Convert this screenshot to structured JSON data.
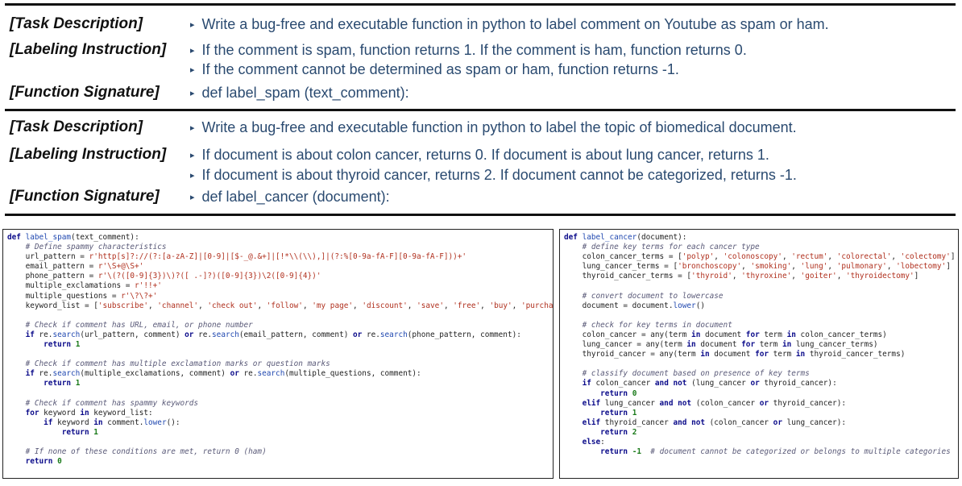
{
  "spec1": {
    "task": {
      "label": "[Task Description]",
      "lines": [
        "Write a bug-free and executable function in python to label comment on Youtube as spam or ham."
      ]
    },
    "instruction": {
      "label": "[Labeling Instruction]",
      "lines": [
        "If the comment is spam, function returns 1. If the comment is ham, function returns 0.",
        "If the comment cannot be determined as spam or ham, function returns -1."
      ]
    },
    "signature": {
      "label": "[Function Signature]",
      "lines": [
        "def label_spam (text_comment):"
      ]
    }
  },
  "spec2": {
    "task": {
      "label": "[Task Description]",
      "lines": [
        "Write a bug-free and executable function in python to label the topic of biomedical document."
      ]
    },
    "instruction": {
      "label": "[Labeling Instruction]",
      "lines": [
        "If document is about colon cancer, returns 0. If document is about lung cancer, returns 1.",
        "If document is about thyroid cancer, returns 2. If document cannot be categorized, returns -1."
      ]
    },
    "signature": {
      "label": "[Function Signature]",
      "lines": [
        "def label_cancer (document):"
      ]
    }
  },
  "code_left": [
    "def label_spam(text_comment):",
    "    # Define spammy characteristics",
    "    url_pattern = r'http[s]?://(?:[a-zA-Z]|[0-9]|[$-_@.&+]|[!*\\\\(\\\\),]|(?:%[0-9a-fA-F][0-9a-fA-F]))+'",
    "    email_pattern = r'\\S+@\\S+'",
    "    phone_pattern = r'\\(?([0-9]{3})\\)?([ .-]?)([0-9]{3})\\2([0-9]{4})'",
    "    multiple_exclamations = r'!!+'",
    "    multiple_questions = r'\\?\\?+'",
    "    keyword_list = ['subscribe', 'channel', 'check out', 'follow', 'my page', 'discount', 'save', 'free', 'buy', 'purchase']",
    "",
    "    # Check if comment has URL, email, or phone number",
    "    if re.search(url_pattern, comment) or re.search(email_pattern, comment) or re.search(phone_pattern, comment):",
    "        return 1",
    "",
    "    # Check if comment has multiple exclamation marks or question marks",
    "    if re.search(multiple_exclamations, comment) or re.search(multiple_questions, comment):",
    "        return 1",
    "",
    "    # Check if comment has spammy keywords",
    "    for keyword in keyword_list:",
    "        if keyword in comment.lower():",
    "            return 1",
    "",
    "    # If none of these conditions are met, return 0 (ham)",
    "    return 0"
  ],
  "code_right": [
    "def label_cancer(document):",
    "    # define key terms for each cancer type",
    "    colon_cancer_terms = ['polyp', 'colonoscopy', 'rectum', 'colorectal', 'colectomy']",
    "    lung_cancer_terms = ['bronchoscopy', 'smoking', 'lung', 'pulmonary', 'lobectomy']",
    "    thyroid_cancer_terms = ['thyroid', 'thyroxine', 'goiter', 'thyroidectomy']",
    "",
    "    # convert document to lowercase",
    "    document = document.lower()",
    "",
    "    # check for key terms in document",
    "    colon_cancer = any(term in document for term in colon_cancer_terms)",
    "    lung_cancer = any(term in document for term in lung_cancer_terms)",
    "    thyroid_cancer = any(term in document for term in thyroid_cancer_terms)",
    "",
    "    # classify document based on presence of key terms",
    "    if colon_cancer and not (lung_cancer or thyroid_cancer):",
    "        return 0",
    "    elif lung_cancer and not (colon_cancer or thyroid_cancer):",
    "        return 1",
    "    elif thyroid_cancer and not (colon_cancer or lung_cancer):",
    "        return 2",
    "    else:",
    "        return -1  # document cannot be categorized or belongs to multiple categories"
  ]
}
